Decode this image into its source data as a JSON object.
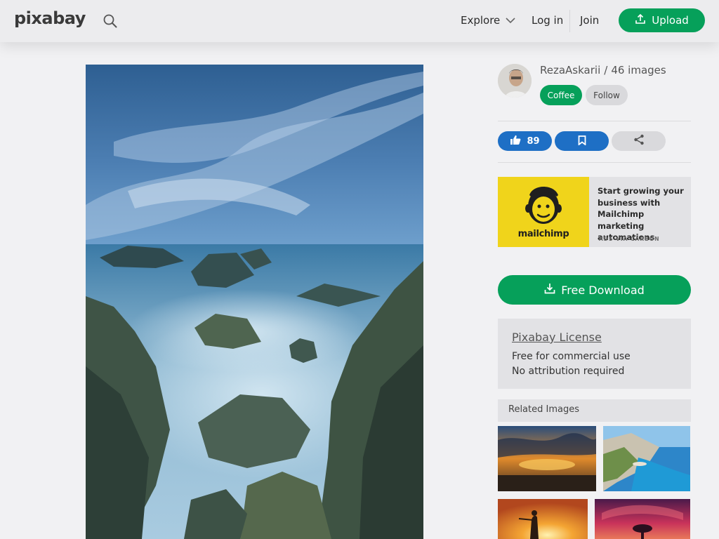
{
  "header": {
    "logo": "pixabay",
    "search_icon": "search-icon",
    "nav": {
      "explore": "Explore",
      "login": "Log in",
      "join": "Join",
      "upload": "Upload"
    }
  },
  "author": {
    "name": "RezaAskarii",
    "separator": "/",
    "images_count": "46 images",
    "coffee_label": "Coffee",
    "follow_label": "Follow"
  },
  "actions": {
    "likes": "89",
    "like_icon": "thumbs-up-icon",
    "save_icon": "bookmark-icon",
    "share_icon": "share-icon"
  },
  "ad": {
    "brand": "mailchimp",
    "text": "Start growing your business with Mailchimp marketing automations",
    "via": "ADS VIA CARBON"
  },
  "download": {
    "label": "Free Download",
    "icon": "download-icon"
  },
  "license": {
    "title": "Pixabay License",
    "line1": "Free for commercial use",
    "line2": "No attribution required"
  },
  "related": {
    "heading": "Related Images"
  },
  "colors": {
    "accent_green": "#06a05a",
    "action_blue": "#1e6fc5",
    "ad_yellow": "#f0d41b"
  }
}
